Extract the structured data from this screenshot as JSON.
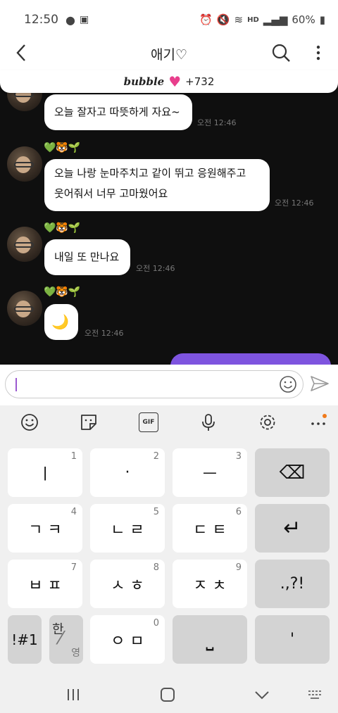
{
  "status": {
    "time": "12:50",
    "battery": "60%",
    "hd_label": "HD"
  },
  "header": {
    "title": "애기♡"
  },
  "bubble": {
    "brand": "bubble",
    "count": "+732"
  },
  "messages": [
    {
      "text": "오늘 잘자고 따뜻하게 자요~",
      "time": "오전 12:46"
    },
    {
      "emojis": "💚🐯🌱",
      "text_line1": "오늘 나랑 눈마주치고 같이 뛰고 응원해주고",
      "text_line2": "웃어줘서 너무 고마웠어요",
      "time": "오전 12:46"
    },
    {
      "emojis": "💚🐯🌱",
      "text": "내일 또 만나요",
      "time": "오전 12:46"
    },
    {
      "emojis": "💚🐯🌱",
      "text": "🌙",
      "time": "오전 12:46"
    }
  ],
  "input": {
    "value": ""
  },
  "keyboard": {
    "toolbar": [
      "emoji-icon",
      "sticker-icon",
      "gif-icon",
      "mic-icon",
      "settings-icon",
      "more-icon"
    ],
    "gif_label": "GIF",
    "keys": [
      {
        "label": "ㅣ",
        "num": "1"
      },
      {
        "label": "·",
        "num": "2"
      },
      {
        "label": "ㅡ",
        "num": "3"
      },
      {
        "label": "⌫"
      },
      {
        "label": "ㄱ ㅋ",
        "num": "4"
      },
      {
        "label": "ㄴ ㄹ",
        "num": "5"
      },
      {
        "label": "ㄷ ㅌ",
        "num": "6"
      },
      {
        "label": "↵"
      },
      {
        "label": "ㅂ ㅍ",
        "num": "7"
      },
      {
        "label": "ㅅ ㅎ",
        "num": "8"
      },
      {
        "label": "ㅈ ㅊ",
        "num": "9"
      },
      {
        "label": ".,?!"
      },
      {
        "label": "!#1"
      },
      {
        "label": "ㅇ ㅁ",
        "num": "0"
      },
      {
        "label": "⎵"
      },
      {
        "label": "'"
      }
    ],
    "lang_han": "한",
    "lang_eng": "영"
  },
  "navbar": [
    "recent-apps-icon",
    "home-icon",
    "back-icon",
    "keyboard-icon"
  ]
}
